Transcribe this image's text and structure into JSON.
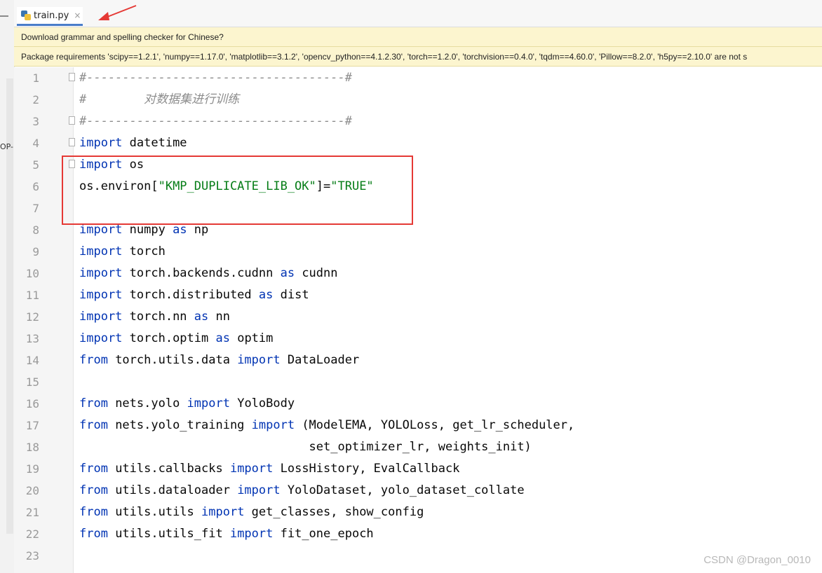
{
  "left_panel": {
    "cut_text": "OP-"
  },
  "tab": {
    "title": "train.py",
    "close": "×"
  },
  "notifications": {
    "grammar": "Download grammar and spelling checker for Chinese?",
    "requirements": "Package requirements 'scipy==1.2.1', 'numpy==1.17.0', 'matplotlib==3.1.2', 'opencv_python==4.1.2.30', 'torch==1.2.0', 'torchvision==0.4.0', 'tqdm==4.60.0', 'Pillow==8.2.0', 'h5py==2.10.0' are not s"
  },
  "code": {
    "lines": [
      {
        "n": "1",
        "t": [
          [
            "#------------------------------------#",
            "cmt"
          ]
        ]
      },
      {
        "n": "2",
        "t": [
          [
            "#        ",
            "cmt"
          ],
          [
            "对数据集进行训练",
            "cmt zh"
          ]
        ]
      },
      {
        "n": "3",
        "t": [
          [
            "#------------------------------------#",
            "cmt"
          ]
        ]
      },
      {
        "n": "4",
        "t": [
          [
            "import",
            "kw"
          ],
          [
            " datetime",
            ""
          ]
        ]
      },
      {
        "n": "5",
        "t": [
          [
            "import",
            "kw"
          ],
          [
            " os",
            ""
          ]
        ]
      },
      {
        "n": "6",
        "t": [
          [
            "os.environ[",
            ""
          ],
          [
            "\"KMP_DUPLICATE_LIB_OK\"",
            "str"
          ],
          [
            "]=",
            ""
          ],
          [
            "\"TRUE\"",
            "str"
          ]
        ]
      },
      {
        "n": "7",
        "t": []
      },
      {
        "n": "8",
        "t": [
          [
            "import",
            "kw"
          ],
          [
            " numpy ",
            ""
          ],
          [
            "as",
            "kw"
          ],
          [
            " np",
            ""
          ]
        ]
      },
      {
        "n": "9",
        "t": [
          [
            "import",
            "kw"
          ],
          [
            " torch",
            ""
          ]
        ]
      },
      {
        "n": "10",
        "t": [
          [
            "import",
            "kw"
          ],
          [
            " torch.backends.cudnn ",
            ""
          ],
          [
            "as",
            "kw"
          ],
          [
            " cudnn",
            ""
          ]
        ]
      },
      {
        "n": "11",
        "t": [
          [
            "import",
            "kw"
          ],
          [
            " torch.distributed ",
            ""
          ],
          [
            "as",
            "kw"
          ],
          [
            " dist",
            ""
          ]
        ]
      },
      {
        "n": "12",
        "t": [
          [
            "import",
            "kw"
          ],
          [
            " torch.nn ",
            ""
          ],
          [
            "as",
            "kw"
          ],
          [
            " nn",
            ""
          ]
        ]
      },
      {
        "n": "13",
        "t": [
          [
            "import",
            "kw"
          ],
          [
            " torch.optim ",
            ""
          ],
          [
            "as",
            "kw"
          ],
          [
            " optim",
            ""
          ]
        ]
      },
      {
        "n": "14",
        "t": [
          [
            "from",
            "kw"
          ],
          [
            " torch.utils.data ",
            ""
          ],
          [
            "import",
            "kw"
          ],
          [
            " DataLoader",
            ""
          ]
        ]
      },
      {
        "n": "15",
        "t": []
      },
      {
        "n": "16",
        "t": [
          [
            "from",
            "kw"
          ],
          [
            " nets.yolo ",
            ""
          ],
          [
            "import",
            "kw"
          ],
          [
            " YoloBody",
            ""
          ]
        ]
      },
      {
        "n": "17",
        "t": [
          [
            "from",
            "kw"
          ],
          [
            " nets.yolo_training ",
            ""
          ],
          [
            "import",
            "kw"
          ],
          [
            " (ModelEMA, YOLOLoss, get_lr_scheduler,",
            ""
          ]
        ]
      },
      {
        "n": "18",
        "t": [
          [
            "                                set_optimizer_lr, weights_init)",
            ""
          ]
        ]
      },
      {
        "n": "19",
        "t": [
          [
            "from",
            "kw"
          ],
          [
            " utils.callbacks ",
            ""
          ],
          [
            "import",
            "kw"
          ],
          [
            " LossHistory, EvalCallback",
            ""
          ]
        ]
      },
      {
        "n": "20",
        "t": [
          [
            "from",
            "kw"
          ],
          [
            " utils.dataloader ",
            ""
          ],
          [
            "import",
            "kw"
          ],
          [
            " YoloDataset, yolo_dataset_collate",
            ""
          ]
        ]
      },
      {
        "n": "21",
        "t": [
          [
            "from",
            "kw"
          ],
          [
            " utils.utils ",
            ""
          ],
          [
            "import",
            "kw"
          ],
          [
            " get_classes, show_config",
            ""
          ]
        ]
      },
      {
        "n": "22",
        "t": [
          [
            "from",
            "kw"
          ],
          [
            " utils.utils_fit ",
            ""
          ],
          [
            "import",
            "kw"
          ],
          [
            " fit_one_epoch",
            ""
          ]
        ]
      },
      {
        "n": "23",
        "t": []
      }
    ],
    "fold_markers": [
      "1",
      "3",
      "4",
      "5"
    ]
  },
  "watermark": "CSDN @Dragon_0010",
  "colors": {
    "keyword": "#0033b3",
    "string": "#067d17",
    "comment": "#8c8c8c",
    "highlight_box": "#e53935",
    "arrow": "#e53935"
  }
}
